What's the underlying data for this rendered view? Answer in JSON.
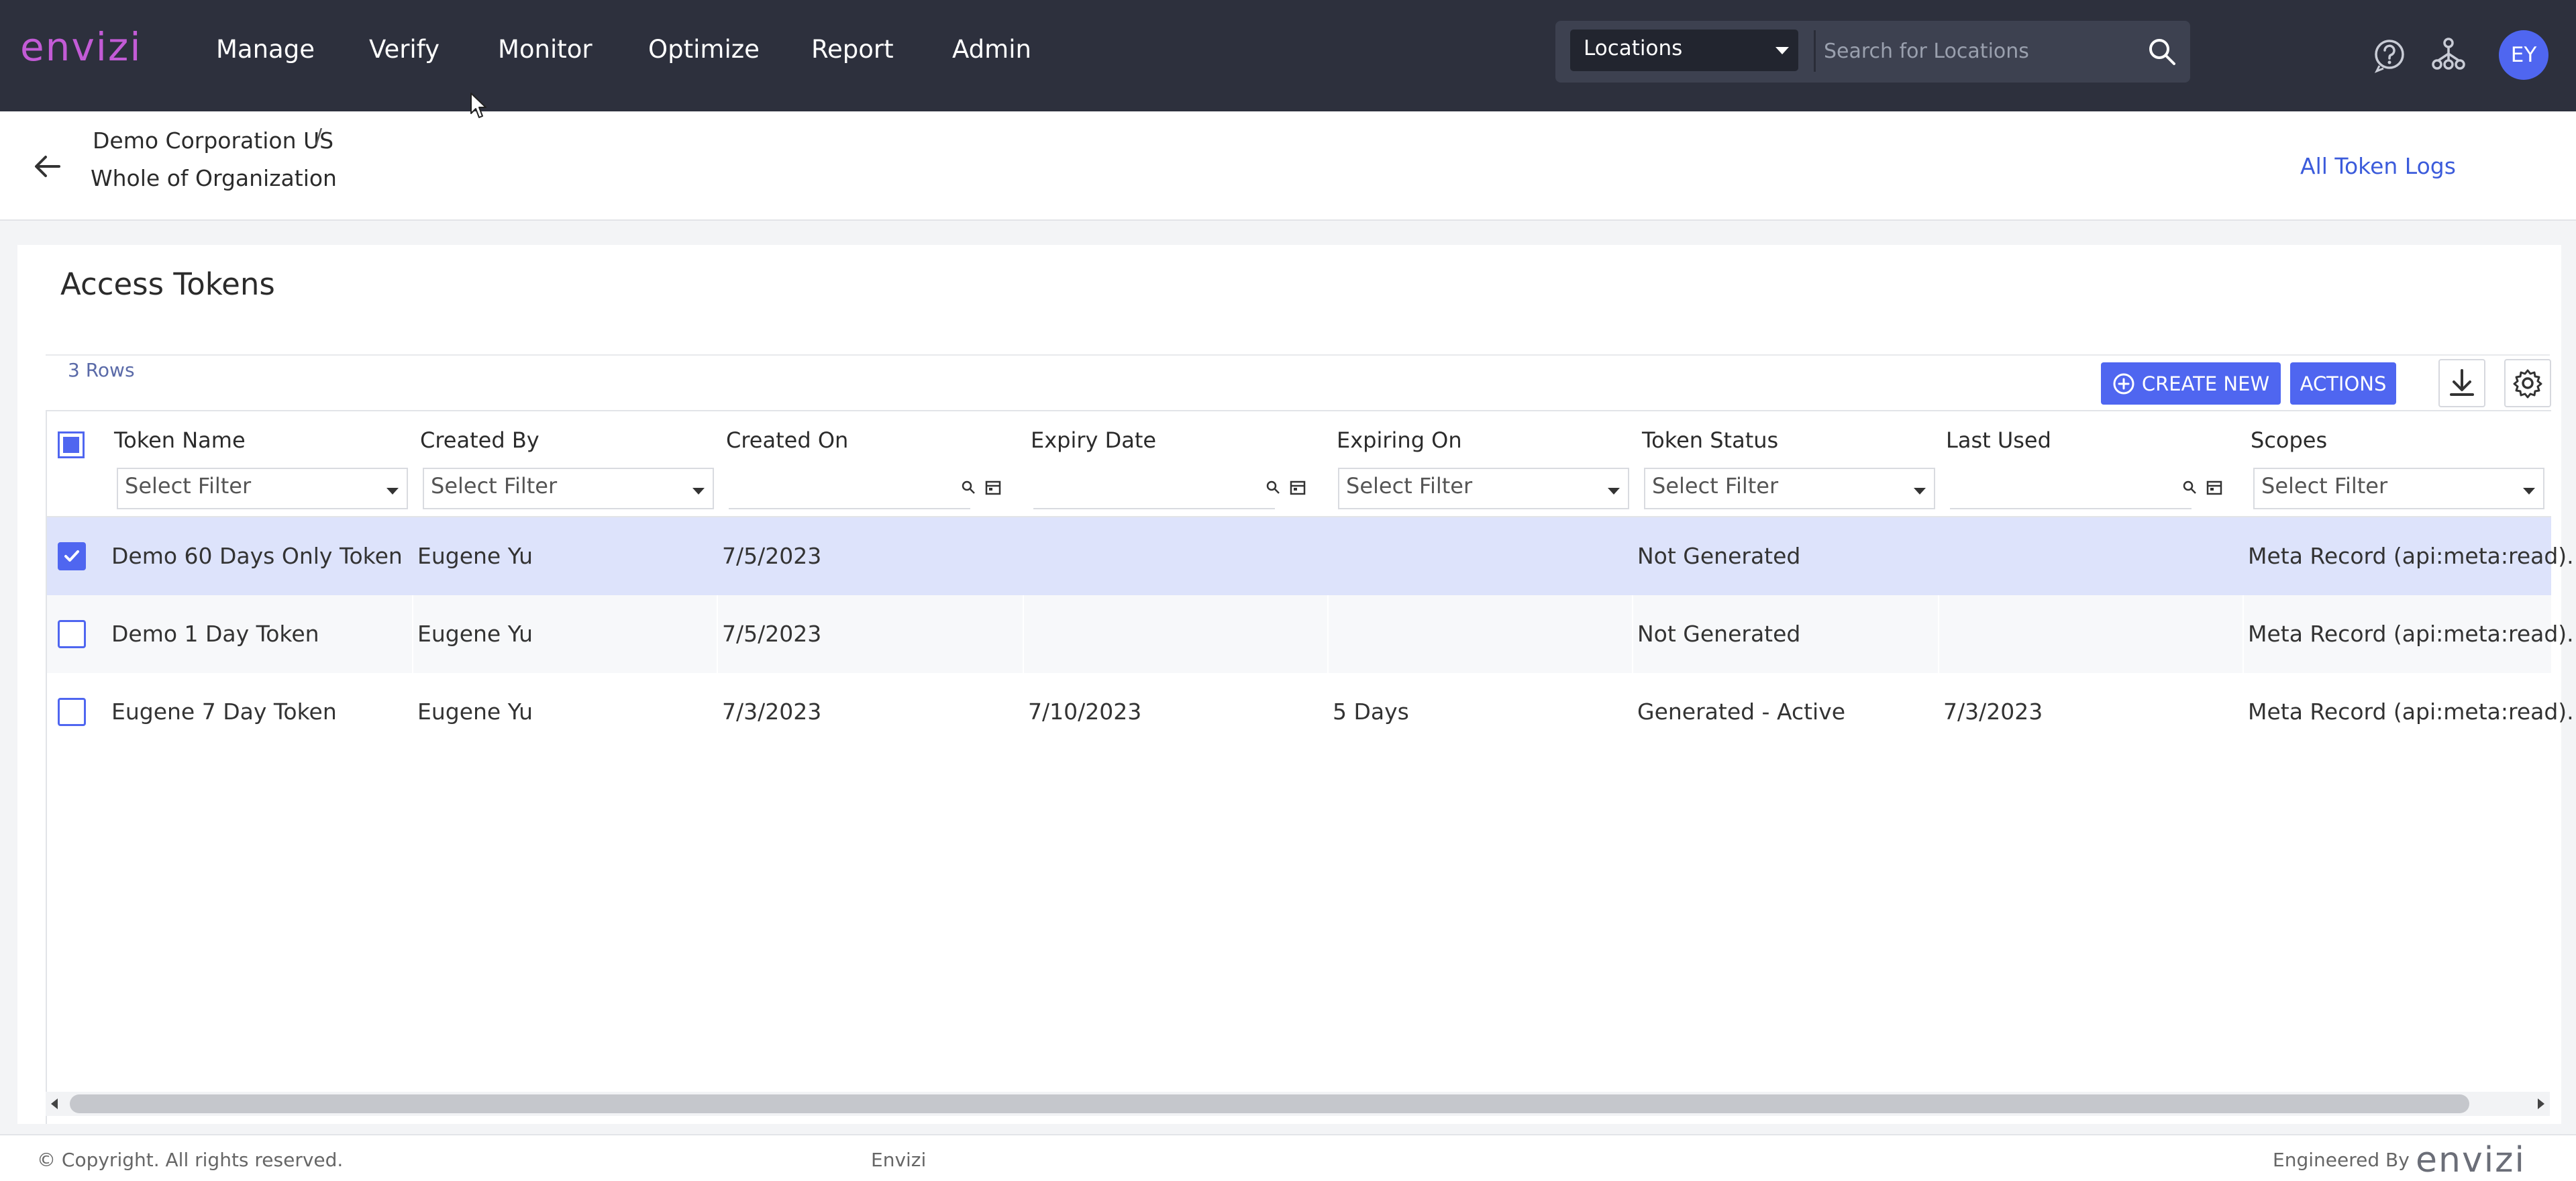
{
  "topbar": {
    "logo_text": "envizi",
    "nav": [
      "Manage",
      "Verify",
      "Monitor",
      "Optimize",
      "Report",
      "Admin"
    ],
    "location_select": "Locations",
    "search_placeholder": "Search for Locations",
    "avatar_initials": "EY",
    "icons": [
      "help-circle-icon",
      "hierarchy-icon",
      "search-icon"
    ]
  },
  "breadcrumb": {
    "org": "Demo Corporation US",
    "separator": "/",
    "scope": "Whole of Organization",
    "right_link": "All Token Logs"
  },
  "page": {
    "title": "Access Tokens",
    "rows_count": "3 Rows",
    "create_label": "CREATE NEW",
    "actions_label": "ACTIONS"
  },
  "table": {
    "columns": [
      "Token Name",
      "Created By",
      "Created On",
      "Expiry Date",
      "Expiring On",
      "Token Status",
      "Last Used",
      "Scopes"
    ],
    "filter_placeholder": "Select Filter",
    "rows": [
      {
        "selected": true,
        "cells": [
          "Demo 60 Days Only Token",
          "Eugene Yu",
          "7/5/2023",
          "",
          "",
          "Not Generated",
          "",
          "Meta Record (api:meta:read)..."
        ]
      },
      {
        "selected": false,
        "cells": [
          "Demo 1 Day Token",
          "Eugene Yu",
          "7/5/2023",
          "",
          "",
          "Not Generated",
          "",
          "Meta Record (api:meta:read)..."
        ]
      },
      {
        "selected": false,
        "cells": [
          "Eugene 7 Day Token",
          "Eugene Yu",
          "7/3/2023",
          "7/10/2023",
          "5 Days",
          "Generated - Active",
          "7/3/2023",
          "Meta Record (api:meta:read)..."
        ]
      }
    ]
  },
  "footer": {
    "copyright": "© Copyright. All rights reserved.",
    "brand": "Envizi",
    "engineered_by": "Engineered By",
    "logo_text": "envizi"
  },
  "colors": {
    "topbar": "#2d303d",
    "accent": "#4f66f0",
    "logo": "#c35bd6",
    "selected_row": "#dde3fb"
  }
}
